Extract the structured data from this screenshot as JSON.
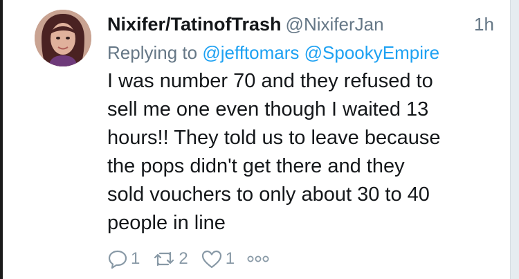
{
  "tweet": {
    "display_name": "Nixifer/TatinofTrash",
    "handle": "@NixiferJan",
    "time": "1h",
    "replying_prefix": "Replying to",
    "mentions": [
      "@jefftomars",
      "@SpookyEmpire"
    ],
    "body_lines": [
      "I was number 70 and they refused to",
      "sell me one even though I waited 13",
      "hours!! They told us to leave because",
      "the pops didn't get there and they",
      "sold vouchers to only about 30 to 40",
      "people in line"
    ],
    "actions": {
      "reply_count": "1",
      "retweet_count": "2",
      "like_count": "1"
    },
    "icons": [
      "reply-icon",
      "retweet-icon",
      "like-icon",
      "more-icon"
    ],
    "colors": {
      "name": "#14171a",
      "meta": "#657786",
      "link": "#1da1f2",
      "action": "#8899a6"
    }
  }
}
